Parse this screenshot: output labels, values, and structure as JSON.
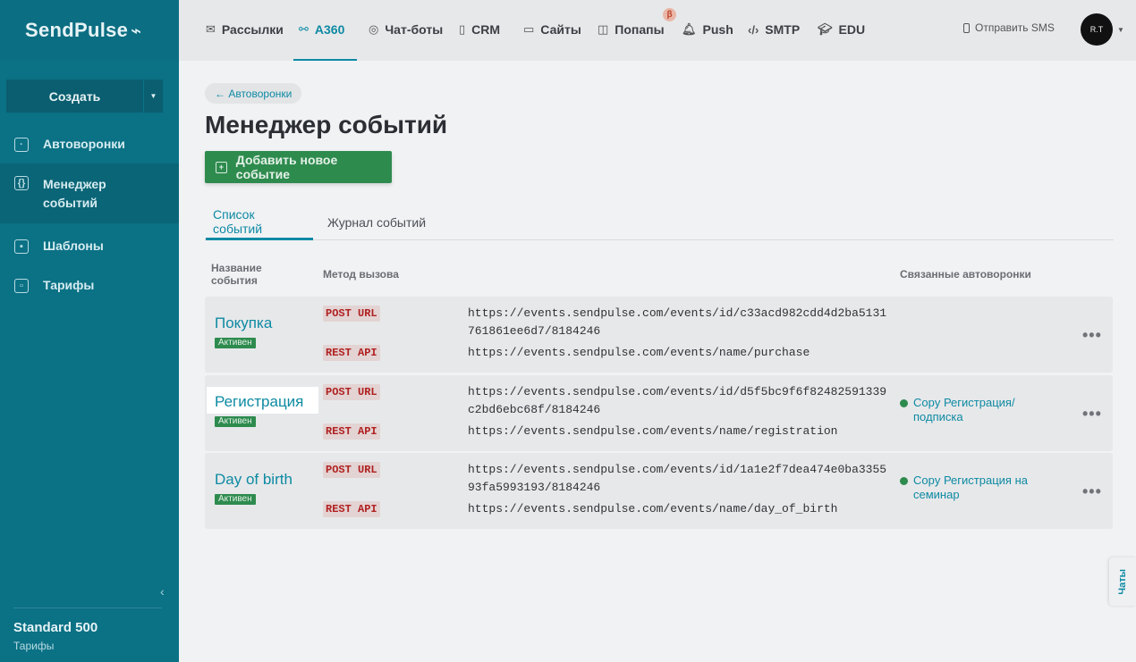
{
  "brand": {
    "name": "SendPulse",
    "pulse": "⌁"
  },
  "sidebar": {
    "create_label": "Создать",
    "items": [
      {
        "label": "Автоворонки",
        "icon": "funnel-icon"
      },
      {
        "label": "Менеджер событий",
        "icon": "braces-icon",
        "active": true
      },
      {
        "label": "Шаблоны",
        "icon": "templates-icon"
      },
      {
        "label": "Тарифы",
        "icon": "calendar-icon"
      }
    ],
    "plan_name": "Standard 500",
    "plan_link": "Тарифы"
  },
  "topnav": {
    "items": [
      {
        "label": "Рассылки",
        "icon": "mail-icon"
      },
      {
        "label": "A360",
        "icon": "nodes-icon",
        "active": true
      },
      {
        "label": "Чат-боты",
        "icon": "chat-icon"
      },
      {
        "label": "CRM",
        "icon": "crm-icon"
      },
      {
        "label": "Сайты",
        "icon": "site-icon"
      },
      {
        "label": "Попапы",
        "icon": "popup-icon"
      },
      {
        "label": "Push",
        "icon": "bell-icon"
      },
      {
        "label": "SMTP",
        "icon": "code-icon"
      },
      {
        "label": "EDU",
        "icon": "graduation-icon"
      }
    ],
    "beta_badge": "β",
    "sms_label": "Отправить SMS",
    "avatar_text": "R.T"
  },
  "main": {
    "back_label": "← Автоворонки",
    "title": "Менеджер событий",
    "add_button": "Добавить новое событие",
    "tabs": [
      {
        "label": "Список событий",
        "active": true
      },
      {
        "label": "Журнал событий"
      }
    ],
    "columns": {
      "name": "Название события",
      "method": "Метод вызова",
      "linked": "Связанные автоворонки"
    },
    "events": [
      {
        "name": "Покупка",
        "status": "Активен",
        "post_label": "POST URL",
        "post_url": "https://events.sendpulse.com/events/id/c33acd982cdd4d2ba5131761861ee6d7/8184246",
        "rest_label": "REST API",
        "rest_url": "https://events.sendpulse.com/events/name/purchase",
        "linked": ""
      },
      {
        "name": "Регистрация",
        "status": "Активен",
        "post_label": "POST URL",
        "post_url": "https://events.sendpulse.com/events/id/d5f5bc9f6f82482591339c2bd6ebc68f/8184246",
        "rest_label": "REST API",
        "rest_url": "https://events.sendpulse.com/events/name/registration",
        "linked": "Copy Регистрация/подписка"
      },
      {
        "name": "Day of birth",
        "status": "Активен",
        "post_label": "POST URL",
        "post_url": "https://events.sendpulse.com/events/id/1a1e2f7dea474e0ba335593fa5993193/8184246",
        "rest_label": "REST API",
        "rest_url": "https://events.sendpulse.com/events/name/day_of_birth",
        "linked": "Copy Регистрация на семинар"
      }
    ],
    "more_label": "•••"
  },
  "chats_label": "Чаты",
  "colors": {
    "accent": "#0d8aa3",
    "sidebar": "#0b7185",
    "success": "#2e8b4e",
    "method": "#b02020"
  }
}
